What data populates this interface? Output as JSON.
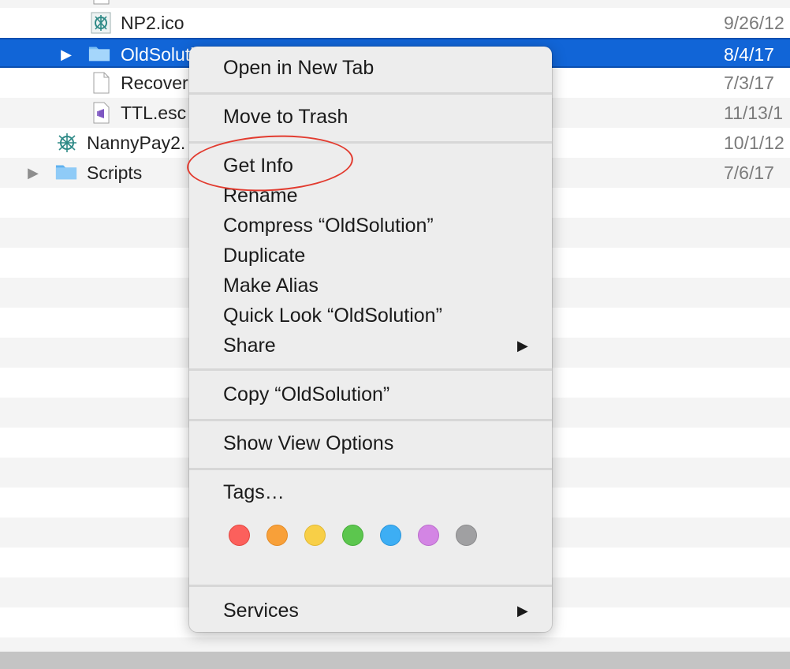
{
  "finder": {
    "files": [
      {
        "name": "NP2.ico",
        "date": "9/26/12"
      },
      {
        "name": "OldSoluti",
        "date": "8/4/17"
      },
      {
        "name": "Recover",
        "date": "7/3/17"
      },
      {
        "name": "TTL.esc",
        "date": "11/13/1"
      },
      {
        "name": "NannyPay2.",
        "date": "10/1/12"
      },
      {
        "name": "Scripts",
        "date": "7/6/17"
      }
    ]
  },
  "context_menu": {
    "open_new_tab": "Open in New Tab",
    "move_to_trash": "Move to Trash",
    "get_info": "Get Info",
    "rename": "Rename",
    "compress": "Compress “OldSolution”",
    "duplicate": "Duplicate",
    "make_alias": "Make Alias",
    "quick_look": "Quick Look “OldSolution”",
    "share": "Share",
    "copy": "Copy “OldSolution”",
    "show_view_options": "Show View Options",
    "tags": "Tags…",
    "services": "Services",
    "tag_colors": [
      {
        "name": "red",
        "fill": "#fc605c",
        "stroke": "#e2463f"
      },
      {
        "name": "orange",
        "fill": "#f8a039",
        "stroke": "#e38a25"
      },
      {
        "name": "yellow",
        "fill": "#f8cf47",
        "stroke": "#e1b832"
      },
      {
        "name": "green",
        "fill": "#5cc64e",
        "stroke": "#46ad3a"
      },
      {
        "name": "blue",
        "fill": "#3daef4",
        "stroke": "#2a95da"
      },
      {
        "name": "purple",
        "fill": "#d385e4",
        "stroke": "#bb6ccc"
      },
      {
        "name": "gray",
        "fill": "#a0a0a2",
        "stroke": "#8a8a8c"
      }
    ]
  }
}
